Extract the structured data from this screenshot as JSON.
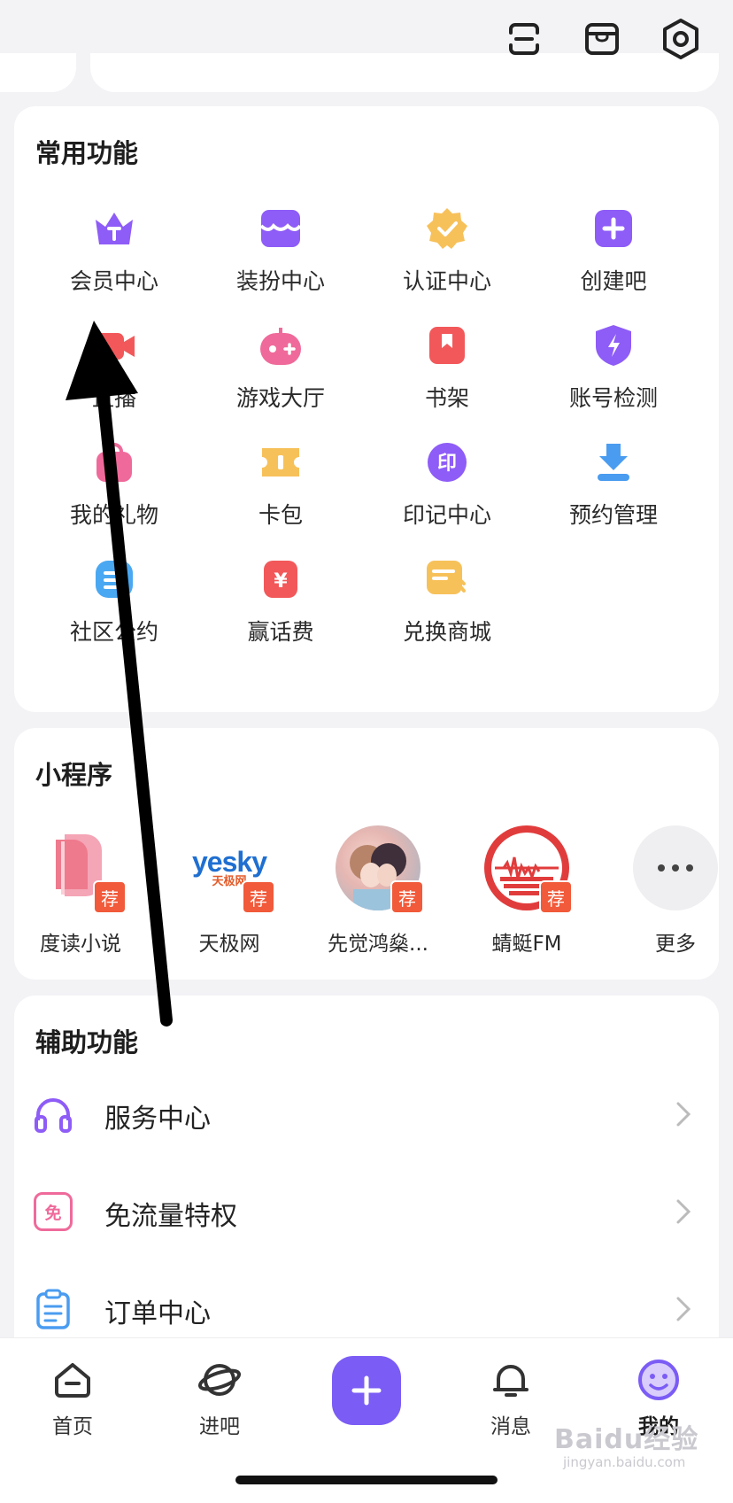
{
  "colors": {
    "accent": "#7b5cf5",
    "background": "#f3f3f6",
    "card": "#ffffff",
    "badge": "#f15a3a"
  },
  "top_icons": [
    "scan-icon",
    "box-icon",
    "settings-icon"
  ],
  "common": {
    "title": "常用功能",
    "items": [
      {
        "label": "会员中心",
        "icon": "crown-icon"
      },
      {
        "label": "装扮中心",
        "icon": "wardrobe-icon"
      },
      {
        "label": "认证中心",
        "icon": "verified-badge-icon"
      },
      {
        "label": "创建吧",
        "icon": "plus-square-icon"
      },
      {
        "label": "直播",
        "icon": "video-camera-icon"
      },
      {
        "label": "游戏大厅",
        "icon": "gamepad-icon"
      },
      {
        "label": "书架",
        "icon": "bookmark-icon"
      },
      {
        "label": "账号检测",
        "icon": "shield-bolt-icon"
      },
      {
        "label": "我的礼物",
        "icon": "gift-bag-icon"
      },
      {
        "label": "卡包",
        "icon": "ticket-icon"
      },
      {
        "label": "印记中心",
        "icon": "seal-icon"
      },
      {
        "label": "预约管理",
        "icon": "download-tray-icon"
      },
      {
        "label": "社区公约",
        "icon": "document-icon"
      },
      {
        "label": "赢话费",
        "icon": "yuan-card-icon"
      },
      {
        "label": "兑换商城",
        "icon": "exchange-note-icon"
      }
    ]
  },
  "mini_programs": {
    "title": "小程序",
    "tag": "荐",
    "items": [
      {
        "label": "度读小说",
        "logo_text": ""
      },
      {
        "label": "天极网",
        "logo_text": "yesky",
        "logo_sub": "天极网"
      },
      {
        "label": "先觉鸿燊...",
        "logo_text": ""
      },
      {
        "label": "蜻蜓FM",
        "logo_text": ""
      }
    ],
    "more_label": "更多"
  },
  "assist": {
    "title": "辅助功能",
    "rows": [
      {
        "label": "服务中心",
        "icon": "headphones-icon"
      },
      {
        "label": "免流量特权",
        "icon": "free-data-icon",
        "icon_text": "免"
      },
      {
        "label": "订单中心",
        "icon": "clipboard-icon"
      }
    ]
  },
  "nav": {
    "items": [
      {
        "label": "首页",
        "icon": "home-icon"
      },
      {
        "label": "进吧",
        "icon": "planet-icon"
      },
      {
        "label": "消息",
        "icon": "bell-icon"
      },
      {
        "label": "我的",
        "icon": "smiley-icon"
      }
    ]
  },
  "watermark": {
    "text": "Baidu经验",
    "sub": "jingyan.baidu.com"
  }
}
